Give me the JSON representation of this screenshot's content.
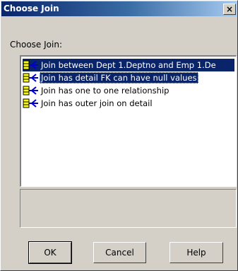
{
  "window": {
    "title": "Choose Join",
    "close_glyph": "×"
  },
  "label": "Choose Join:",
  "list": {
    "items": [
      {
        "label": "Join between Dept 1.Deptno and Emp 1.De",
        "icon": "join-icon",
        "selected": true
      },
      {
        "label": "Join has detail FK can have null values",
        "icon": "join-icon",
        "selected": true,
        "focused": true
      },
      {
        "label": "Join has one to one relationship",
        "icon": "join-icon",
        "selected": false
      },
      {
        "label": "Join has outer join on detail",
        "icon": "join-icon",
        "selected": false
      }
    ]
  },
  "description": "",
  "buttons": {
    "ok": "OK",
    "cancel": "Cancel",
    "help": "Help"
  },
  "colors": {
    "selection": "#0a246a",
    "face": "#d4d0c8",
    "join_icon_yellow": "#ffff00",
    "join_icon_blue": "#0000cc"
  }
}
